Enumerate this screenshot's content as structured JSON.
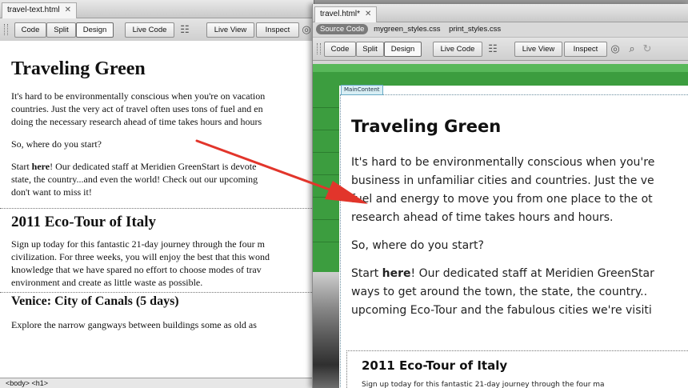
{
  "left_window": {
    "tab_title": "travel-text.html",
    "toolbar": {
      "code": "Code",
      "split": "Split",
      "design": "Design",
      "live_code": "Live Code",
      "live_view": "Live View",
      "inspect": "Inspect"
    },
    "heading": "Traveling Green",
    "para1": "It's hard to be environmentally conscious when you're on vacation",
    "para1b": "countries. Just the very act of travel often uses tons of fuel and en",
    "para1c": "doing the necessary research ahead of time takes hours and hours",
    "para2": "So, where do you start?",
    "para3_before": "Start ",
    "para3_bold": "here",
    "para3_after": "! Our dedicated staff at Meridien GreenStart is devote",
    "para3b": "state, the country...and even the world! Check out our upcoming",
    "para3c": "don't want to miss it!",
    "heading2": "2011 Eco-Tour of Italy",
    "para4a": "Sign up today for this fantastic 21-day journey through the four m",
    "para4b": "civilization. For three weeks, you will enjoy the best that this wond",
    "para4c": "knowledge that we have spared no effort to choose modes of trav",
    "para4d": "environment and create as little waste as possible.",
    "heading3": "Venice: City of Canals (5 days)",
    "para5": "Explore the narrow gangways between buildings some as old as",
    "status_bar": "<body> <h1>"
  },
  "right_window": {
    "tab_title": "travel.html*",
    "related_files": {
      "source_code": "Source Code",
      "file1": "mygreen_styles.css",
      "file2": "print_styles.css"
    },
    "toolbar": {
      "code": "Code",
      "split": "Split",
      "design": "Design",
      "live_code": "Live Code",
      "live_view": "Live View",
      "inspect": "Inspect"
    },
    "main_content_label": "MainContent",
    "heading": "Traveling Green",
    "para1a": "It's hard to be environmentally conscious when you're",
    "para1b": "business in unfamiliar cities and countries. Just the ve",
    "para1c": "fuel and energy to move you from one place to the ot",
    "para1d": "research ahead of time takes hours and hours.",
    "para2": "So, where do you start?",
    "para3_before": "Start ",
    "para3_bold": "here",
    "para3_after": "! Our dedicated staff at Meridien GreenStar",
    "para3b": "ways to get around the town, the state, the country..",
    "para3c": "upcoming Eco-Tour and the fabulous cities we're visiti",
    "heading2": "2011 Eco-Tour of Italy",
    "para4_cut": "Sign up today for this fantastic 21-day journey through the four ma"
  },
  "colors": {
    "arrow": "#e2352b",
    "green": "#3c9d3f"
  }
}
